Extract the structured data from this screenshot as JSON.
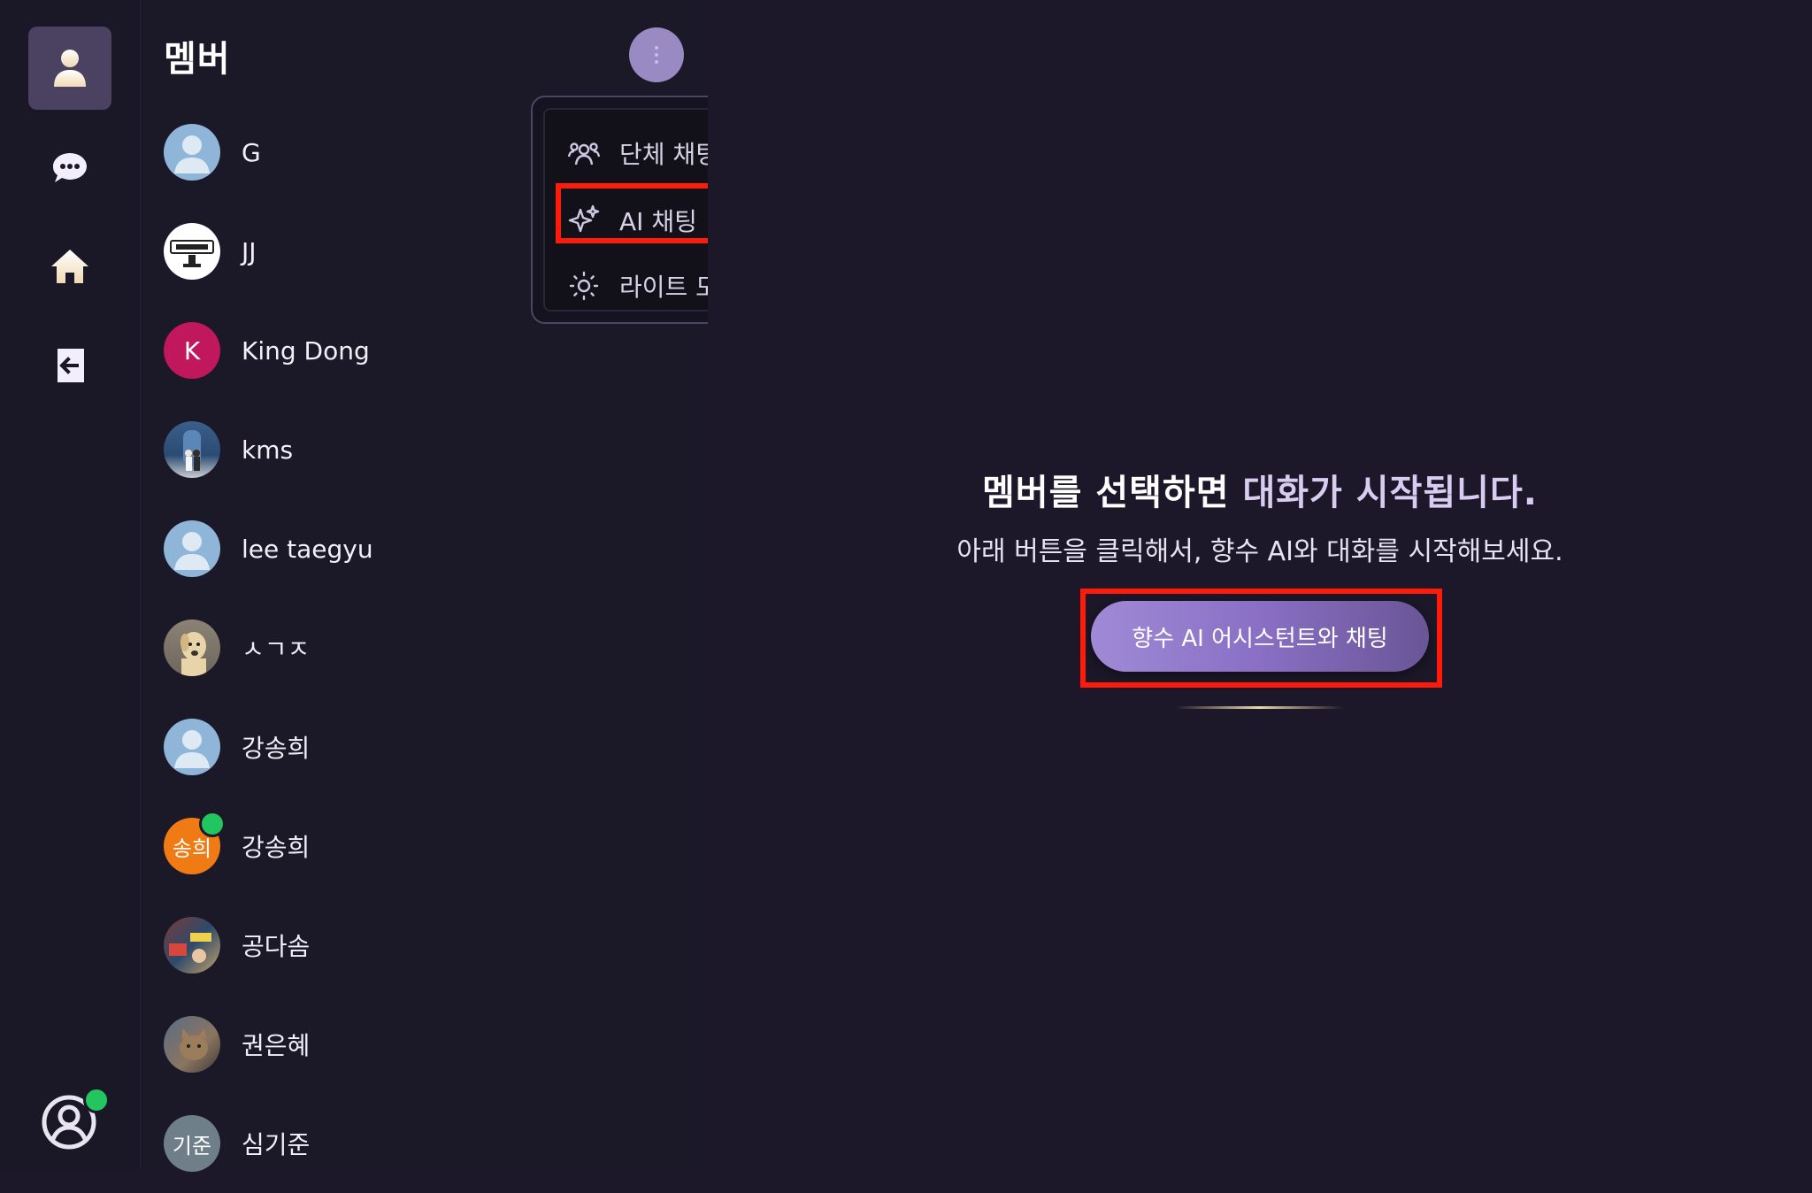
{
  "sidebar": {
    "items": [
      {
        "name": "user-icon",
        "active": true
      },
      {
        "name": "chat-icon",
        "active": false
      },
      {
        "name": "home-icon",
        "active": false
      },
      {
        "name": "logout-icon",
        "active": false
      }
    ],
    "profile": {
      "online": true
    }
  },
  "members_panel": {
    "title": "멤버",
    "members": [
      {
        "name": "G",
        "avatar": "default-avatar"
      },
      {
        "name": "JJ",
        "avatar": "stamp-avatar"
      },
      {
        "name": "King Dong",
        "avatar": "initial",
        "initial": "K",
        "color": "#c0175d"
      },
      {
        "name": "kms",
        "avatar": "photo-avatar"
      },
      {
        "name": "lee taegyu",
        "avatar": "default-avatar"
      },
      {
        "name": "ㅅㄱㅈ",
        "avatar": "dog-photo-avatar"
      },
      {
        "name": "강송희",
        "avatar": "default-avatar"
      },
      {
        "name": "강송희",
        "avatar": "initial",
        "initial": "송희",
        "color": "#f07a14",
        "online": true
      },
      {
        "name": "공다솜",
        "avatar": "photo-avatar"
      },
      {
        "name": "권은혜",
        "avatar": "cat-photo-avatar"
      },
      {
        "name": "심기준",
        "avatar": "initial",
        "initial": "기준",
        "color": "#6e7f8a"
      }
    ]
  },
  "menu": {
    "items": [
      {
        "label": "단체 채팅",
        "icon": "group-icon"
      },
      {
        "label": "AI 채팅",
        "icon": "sparkle-icon",
        "highlighted": true
      },
      {
        "label": "라이트 모드",
        "icon": "sun-icon"
      }
    ]
  },
  "main": {
    "heading_plain": "멤버를 선택하면 ",
    "heading_accent": "대화가 시작됩니다.",
    "subtext": "아래 버튼을 클릭해서, 향수 AI와 대화를 시작해보세요.",
    "cta_label": "향수 AI 어시스턴트와 채팅"
  },
  "colors": {
    "background": "#1c1829",
    "accent": "#9a8ac4",
    "highlight": "#ff1a0a",
    "online": "#22c55e"
  }
}
